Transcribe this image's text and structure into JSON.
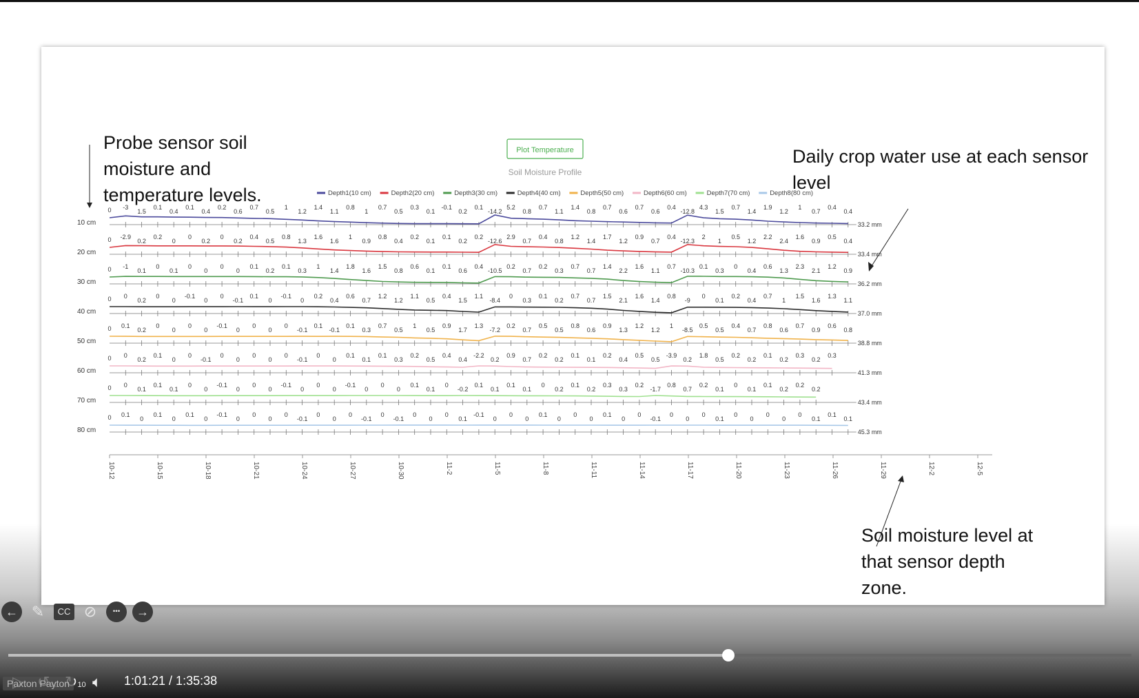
{
  "slide": {
    "annotations": {
      "left": "Probe sensor soil\nmoisture and\ntemperature levels.",
      "top_right": "Daily crop water use at each sensor\nlevel",
      "bottom_right": "Soil moisture level at\nthat sensor depth\nzone."
    }
  },
  "chart": {
    "button_label": "Plot Temperature",
    "title": "Soil Moisture Profile",
    "legend": [
      "Depth1(10 cm)",
      "Depth2(20 cm)",
      "Depth3(30 cm)",
      "Depth4(40 cm)",
      "Depth5(50 cm)",
      "Depth6(60 cm)",
      "Depth7(70 cm)",
      "Depth8(80 cm)"
    ],
    "colors": [
      "#4b4a9c",
      "#d9363e",
      "#4e9a4e",
      "#2b2b2b",
      "#f0b24a",
      "#f2b6c6",
      "#9fe08f",
      "#a8c8e8"
    ],
    "y_labels": [
      "10 cm",
      "20 cm",
      "30 cm",
      "40 cm",
      "50 cm",
      "60 cm",
      "70 cm",
      "80 cm"
    ],
    "x_ticks": [
      "10-12",
      "10-15",
      "10-18",
      "10-21",
      "10-24",
      "10-27",
      "10-30",
      "11-2",
      "11-5",
      "11-8",
      "11-11",
      "11-14",
      "11-17",
      "11-20",
      "11-23",
      "11-26",
      "11-29",
      "12-2",
      "12-5"
    ],
    "end_labels": [
      "33.2 mm",
      "33.4 mm",
      "36.2 mm",
      "37.0 mm",
      "38.8 mm",
      "41.3 mm",
      "43.4 mm",
      "45.3 mm"
    ],
    "first_values": [
      "0",
      "0",
      "0",
      "0",
      "0",
      "0",
      "0",
      "0"
    ]
  },
  "chart_data": {
    "type": "line",
    "x_start": "10-12",
    "x_end": "11-28",
    "x_step_days": 1,
    "events": [
      {
        "x": "11-4"
      },
      {
        "x": "11-16"
      }
    ],
    "series": [
      {
        "name": "Depth1(10 cm)",
        "daily_use": [
          "-3",
          "1.5",
          "0.1",
          "0.4",
          "0.1",
          "0.4",
          "0.2",
          "0.6",
          "0.7",
          "0.5",
          "1",
          "1.2",
          "1.4",
          "1.1",
          "0.8",
          "1",
          "0.7",
          "0.5",
          "0.3",
          "0.1",
          "-0.1",
          "0.2",
          "0.1",
          "-14.2",
          "5.2",
          "0.8",
          "0.7",
          "1.1",
          "1.4",
          "0.8",
          "0.7",
          "0.6",
          "0.7",
          "0.6",
          "0.4",
          "-12.8",
          "4.3",
          "1.5",
          "0.7",
          "1.4",
          "1.9",
          "1.2",
          "1",
          "0.7",
          "0.4",
          "0.4"
        ],
        "end": "33.2 mm"
      },
      {
        "name": "Depth2(20 cm)",
        "daily_use": [
          "-2.9",
          "0.2",
          "0.2",
          "0",
          "0",
          "0.2",
          "0",
          "0.2",
          "0.4",
          "0.5",
          "0.8",
          "1.3",
          "1.6",
          "1.6",
          "1",
          "0.9",
          "0.8",
          "0.4",
          "0.2",
          "0.1",
          "0.1",
          "0.2",
          "0.2",
          "-12.6",
          "2.9",
          "0.7",
          "0.4",
          "0.8",
          "1.2",
          "1.4",
          "1.7",
          "1.2",
          "0.9",
          "0.7",
          "0.4",
          "-12.3",
          "2",
          "1",
          "0.5",
          "1.2",
          "2.2",
          "2.4",
          "1.6",
          "0.9",
          "0.5",
          "0.4"
        ],
        "end": "33.4 mm"
      },
      {
        "name": "Depth3(30 cm)",
        "daily_use": [
          "-1",
          "0.1",
          "0",
          "0.1",
          "0",
          "0",
          "0",
          "0",
          "0.1",
          "0.2",
          "0.1",
          "0.3",
          "1",
          "1.4",
          "1.8",
          "1.6",
          "1.5",
          "0.8",
          "0.6",
          "0.1",
          "0.1",
          "0.6",
          "0.4",
          "-10.5",
          "0.2",
          "0.7",
          "0.2",
          "0.3",
          "0.7",
          "0.7",
          "1.4",
          "2.2",
          "1.6",
          "1.1",
          "0.7",
          "-10.3",
          "0.1",
          "0.3",
          "0",
          "0.4",
          "0.6",
          "1.3",
          "2.3",
          "2.1",
          "1.2",
          "0.9"
        ],
        "end": "36.2 mm"
      },
      {
        "name": "Depth4(40 cm)",
        "daily_use": [
          "0",
          "0.2",
          "0",
          "0",
          "-0.1",
          "0",
          "0",
          "-0.1",
          "0.1",
          "0",
          "-0.1",
          "0",
          "0.2",
          "0.4",
          "0.6",
          "0.7",
          "1.2",
          "1.2",
          "1.1",
          "0.5",
          "0.4",
          "1.5",
          "1.1",
          "-8.4",
          "0",
          "0.3",
          "0.1",
          "0.2",
          "0.7",
          "0.7",
          "1.5",
          "2.1",
          "1.6",
          "1.4",
          "0.8",
          "-9",
          "0",
          "0.1",
          "0.2",
          "0.4",
          "0.7",
          "1",
          "1.5",
          "1.6",
          "1.3",
          "1.1"
        ],
        "end": "37.0 mm"
      },
      {
        "name": "Depth5(50 cm)",
        "daily_use": [
          "0.1",
          "0.2",
          "0",
          "0",
          "0",
          "0",
          "-0.1",
          "0",
          "0",
          "0",
          "0",
          "-0.1",
          "0.1",
          "-0.1",
          "0.1",
          "0.3",
          "0.7",
          "0.5",
          "1",
          "0.5",
          "0.9",
          "1.7",
          "1.3",
          "-7.2",
          "0.2",
          "0.7",
          "0.5",
          "0.5",
          "0.8",
          "0.6",
          "0.9",
          "1.3",
          "1.2",
          "1.2",
          "1",
          "-8.5",
          "0.5",
          "0.5",
          "0.4",
          "0.7",
          "0.8",
          "0.6",
          "0.7",
          "0.9",
          "0.6",
          "0.8"
        ],
        "end": "38.8 mm"
      },
      {
        "name": "Depth6(60 cm)",
        "daily_use": [
          "0",
          "0.2",
          "0.1",
          "0",
          "0",
          "-0.1",
          "0",
          "0",
          "0",
          "0",
          "0",
          "-0.1",
          "0",
          "0",
          "0.1",
          "0.1",
          "0.1",
          "0.3",
          "0.2",
          "0.5",
          "0.4",
          "0.4",
          "-2.2",
          "0.2",
          "0.9",
          "0.7",
          "0.2",
          "0.2",
          "0.1",
          "0.1",
          "0.2",
          "0.4",
          "0.5",
          "0.5",
          "-3.9",
          "0.2",
          "1.8",
          "0.5",
          "0.2",
          "0.2",
          "0.1",
          "0.2",
          "0.3",
          "0.2",
          "0.3"
        ],
        "end": "41.3 mm"
      },
      {
        "name": "Depth7(70 cm)",
        "daily_use": [
          "0",
          "0.1",
          "0.1",
          "0.1",
          "0",
          "0",
          "-0.1",
          "0",
          "0",
          "0",
          "-0.1",
          "0",
          "0",
          "0",
          "-0.1",
          "0",
          "0",
          "0",
          "0.1",
          "0.1",
          "0",
          "-0.2",
          "0.1",
          "0.1",
          "0.1",
          "0.1",
          "0",
          "0.2",
          "0.1",
          "0.2",
          "0.3",
          "0.3",
          "0.2",
          "-1.7",
          "0.8",
          "0.7",
          "0.2",
          "0.1",
          "0",
          "0.1",
          "0.1",
          "0.2",
          "0.2",
          "0.2"
        ],
        "end": "43.4 mm"
      },
      {
        "name": "Depth8(80 cm)",
        "daily_use": [
          "0.1",
          "0",
          "0.1",
          "0",
          "0.1",
          "0",
          "-0.1",
          "0",
          "0",
          "0",
          "0",
          "-0.1",
          "0",
          "0",
          "0",
          "-0.1",
          "0",
          "-0.1",
          "0",
          "0",
          "0",
          "0.1",
          "-0.1",
          "0",
          "0",
          "0",
          "0.1",
          "0",
          "0",
          "0",
          "0.1",
          "0",
          "0",
          "-0.1",
          "0",
          "0",
          "0",
          "0.1",
          "0",
          "0",
          "0",
          "0",
          "0",
          "0.1",
          "0.1",
          "0.1"
        ],
        "end": "45.3 mm"
      }
    ]
  },
  "player": {
    "time": "1:01:21 / 1:35:38",
    "progress": 0.641,
    "user": "Paxton Payton",
    "skip_back": "10",
    "skip_fwd": "10",
    "top_icons": [
      "back-arrow-icon",
      "pencil-icon",
      "cc-icon",
      "camera-off-icon",
      "more-icon",
      "forward-arrow-icon"
    ]
  }
}
